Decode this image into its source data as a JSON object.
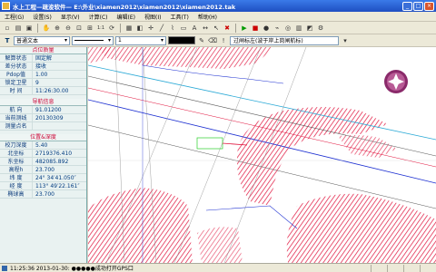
{
  "window": {
    "title": "水上工程—疏浚软件— E:\\外业\\xiamen2012\\xiamen2012\\xiamen2012.tak"
  },
  "menu": [
    "工程(G)",
    "设置(S)",
    "显示(V)",
    "计算(C)",
    "编辑(E)",
    "视图(I)",
    "工具(T)",
    "帮助(H)"
  ],
  "toolbar": {
    "text_style": "普通文本",
    "line_width": "1",
    "hint": "过闸标左(波于岸上岗闸航标)"
  },
  "panel": {
    "sections": [
      {
        "title": "点位质量",
        "rows": [
          {
            "label": "解算状态",
            "value": "固定解"
          },
          {
            "label": "差分状态",
            "value": "接收"
          },
          {
            "label": "Pdop值",
            "value": "1.00"
          },
          {
            "label": "锁定卫星",
            "value": "9"
          },
          {
            "label": "时  间",
            "value": "11:26:30.00"
          }
        ]
      },
      {
        "title": "导航信息",
        "rows": [
          {
            "label": "航  向",
            "value": "91.01200"
          },
          {
            "label": "当前测线",
            "value": "20130309"
          },
          {
            "label": "测量点名",
            "value": ""
          }
        ]
      },
      {
        "title": "位置&深度",
        "rows": [
          {
            "label": "校刀深度",
            "value": "5.40"
          },
          {
            "label": "北坐标",
            "value": "2719376.410"
          },
          {
            "label": "东坐标",
            "value": "482085.892"
          },
          {
            "label": "高程h",
            "value": "23.700"
          },
          {
            "label": "纬  度",
            "value": "24° 34′41.050″"
          },
          {
            "label": "经  度",
            "value": "113° 49′22.161″"
          },
          {
            "label": "椭球高",
            "value": "23.700"
          }
        ]
      }
    ]
  },
  "status": {
    "text": "11:25:36 2013-01-30: ●●●●●成功打开GPS口"
  }
}
